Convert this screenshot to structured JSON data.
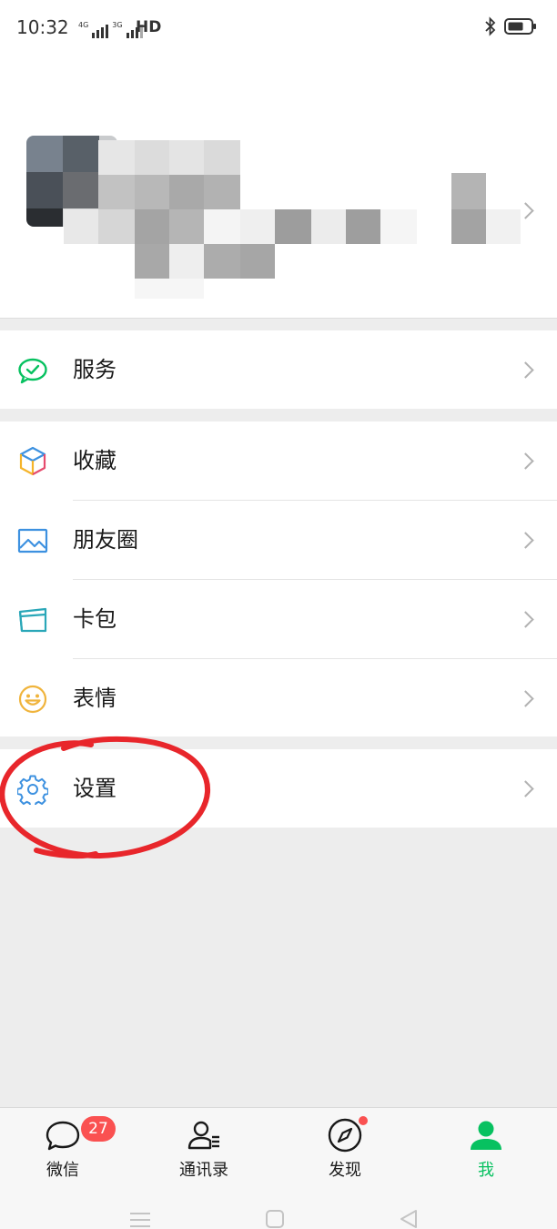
{
  "status_bar": {
    "time": "10:32",
    "network_1": "4G",
    "network_2": "3G",
    "hd": "HD"
  },
  "menu": {
    "services": "服务",
    "favorites": "收藏",
    "moments": "朋友圈",
    "cards": "卡包",
    "stickers": "表情",
    "settings": "设置"
  },
  "tabbar": {
    "chats": {
      "label": "微信",
      "badge": "27"
    },
    "contacts": {
      "label": "通讯录"
    },
    "discover": {
      "label": "发现"
    },
    "me": {
      "label": "我"
    }
  },
  "colors": {
    "accent": "#07c160",
    "badge": "#fa5151",
    "annotation": "#e8262b"
  }
}
